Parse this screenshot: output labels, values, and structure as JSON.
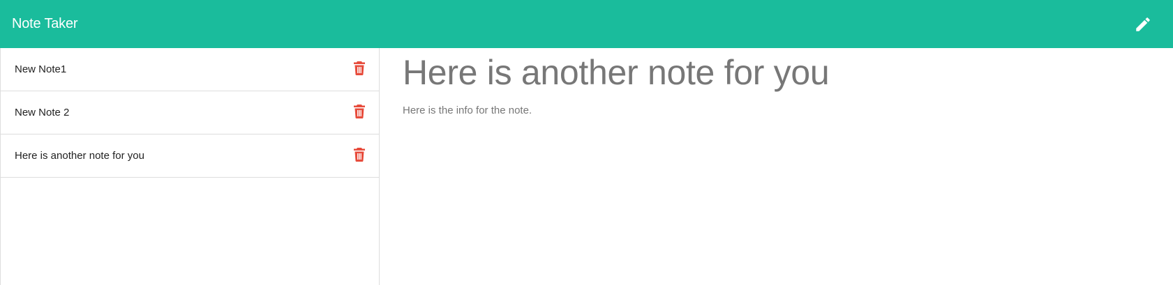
{
  "app": {
    "title": "Note Taker"
  },
  "navbar": {
    "edit_icon": "pencil-icon",
    "background_color": "#1abc9c"
  },
  "sidebar": {
    "notes": [
      {
        "title": "New Note1",
        "delete_icon": "trash-icon"
      },
      {
        "title": "New Note 2",
        "delete_icon": "trash-icon"
      },
      {
        "title": "Here is another note for you",
        "delete_icon": "trash-icon"
      }
    ],
    "delete_color": "#e74c3c"
  },
  "editor": {
    "title": "Here is another note for you",
    "body": "Here is the info for the note."
  }
}
